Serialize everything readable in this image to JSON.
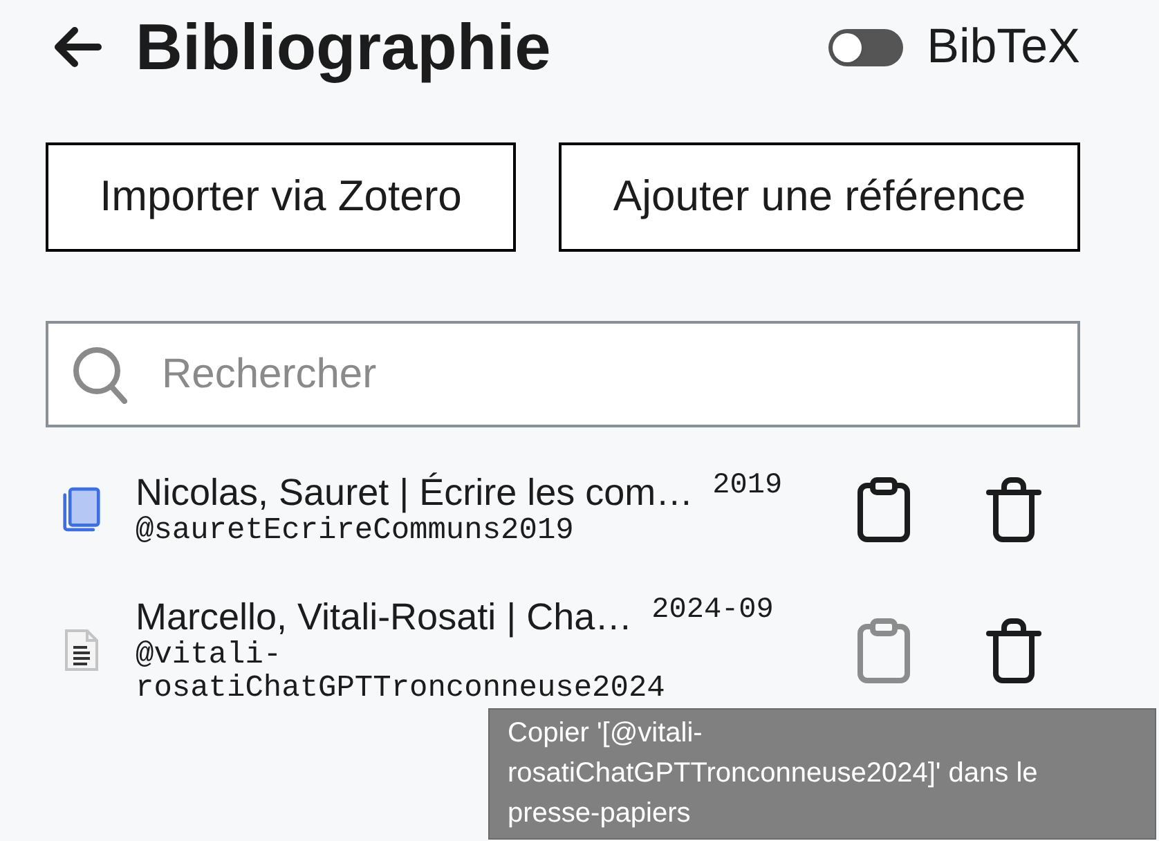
{
  "header": {
    "title": "Bibliographie",
    "bibtex_toggle": {
      "label": "BibTeX",
      "on": false
    }
  },
  "actions": [
    "Importer via Zotero",
    "Ajouter une référence"
  ],
  "search": {
    "placeholder": "Rechercher"
  },
  "references": [
    {
      "kind": "book",
      "title": "Nicolas, Sauret | Écrire les com…",
      "date": "2019",
      "key": "@sauretEcrireCommuns2019",
      "copy_hovered": false
    },
    {
      "kind": "article",
      "title": "Marcello, Vitali-Rosati | Cha…",
      "date": "2024-09",
      "key": "@vitali-rosatiChatGPTTronconneuse2024",
      "copy_hovered": true
    }
  ],
  "tooltip": {
    "text": "Copier '[@vitali-rosatiChatGPTTronconneuse2024]' dans le presse-papiers"
  }
}
